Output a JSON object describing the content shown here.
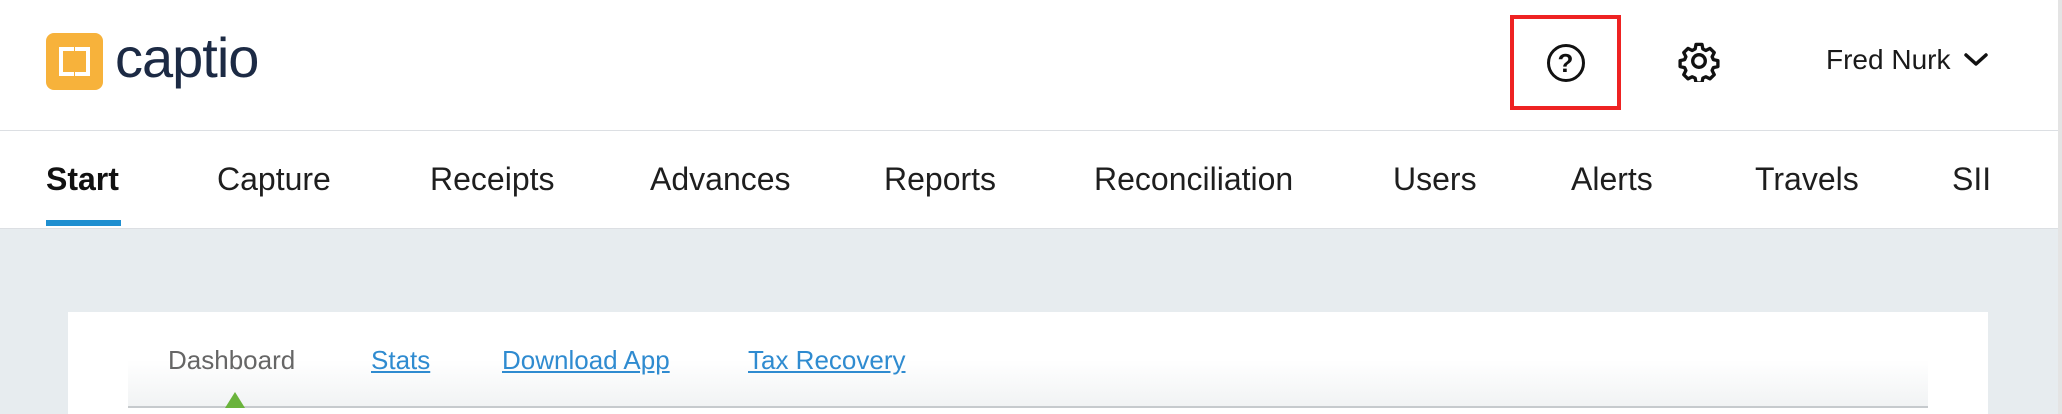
{
  "brand": {
    "name": "captio",
    "color": "#f7b23b"
  },
  "header": {
    "help_glyph": "?",
    "help_icon": "question-circle-icon",
    "settings_icon": "gear-icon",
    "user": {
      "name": "Fred Nurk",
      "menu_icon": "chevron-down-icon"
    }
  },
  "nav": {
    "items": [
      {
        "label": "Start",
        "active": true
      },
      {
        "label": "Capture"
      },
      {
        "label": "Receipts"
      },
      {
        "label": "Advances"
      },
      {
        "label": "Reports"
      },
      {
        "label": "Reconciliation"
      },
      {
        "label": "Users"
      },
      {
        "label": "Alerts"
      },
      {
        "label": "Travels"
      },
      {
        "label": "SII"
      }
    ],
    "accent_color": "#1f8fd0"
  },
  "subtabs": {
    "items": [
      {
        "label": "Dashboard",
        "active": true
      },
      {
        "label": "Stats"
      },
      {
        "label": "Download App"
      },
      {
        "label": "Tax Recovery"
      }
    ],
    "link_color": "#2f8bd0",
    "pointer_color": "#6ab33c"
  },
  "highlight_color": "#ee2222"
}
